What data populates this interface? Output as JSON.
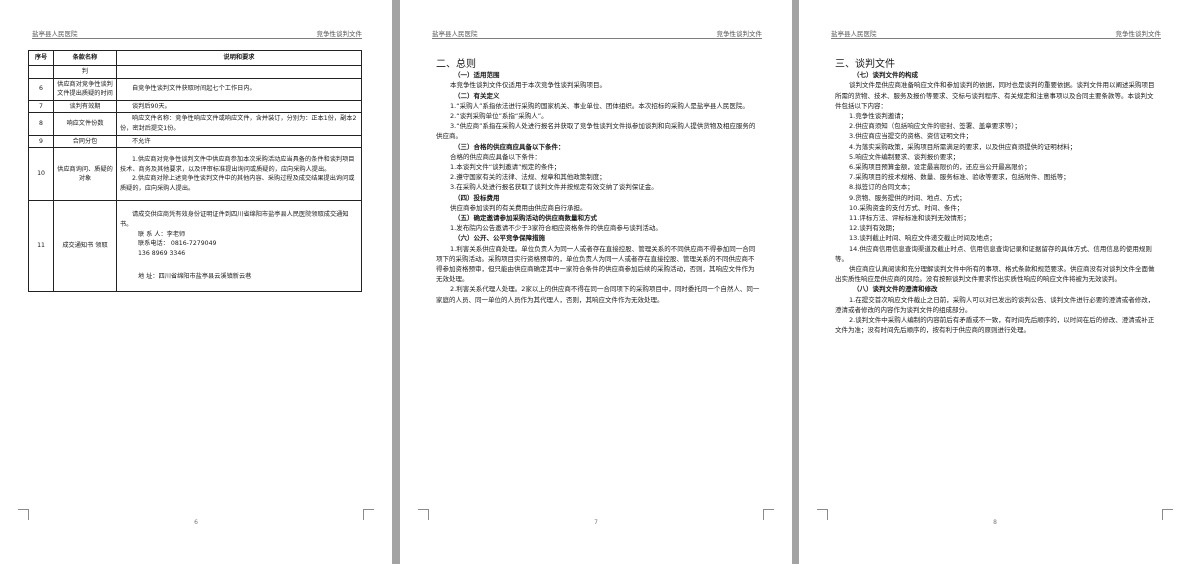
{
  "header": {
    "left": "盐亭县人民医院",
    "right": "竞争性谈判文件"
  },
  "page6": {
    "page_number": "6",
    "table_headers": [
      "序号",
      "条款名称",
      "说明和要求"
    ],
    "rows": [
      {
        "no": "",
        "name": "判",
        "desc": []
      },
      {
        "no": "6",
        "name": "供应商对竞争性谈判文件提出质疑的时间",
        "desc": [
          "自竞争性谈判文件获取时间起七个工作日内。"
        ]
      },
      {
        "no": "7",
        "name": "谈判有效期",
        "desc": [
          "谈判后90天。"
        ]
      },
      {
        "no": "8",
        "name": "响应文件份数",
        "desc": [
          "响应文件名称：竞争性响应文件或响应文件，含并装订，分别为：正本1份，副本2份，密封后提交1份。"
        ]
      },
      {
        "no": "9",
        "name": "合同分包",
        "desc": [
          "不允许"
        ]
      },
      {
        "no": "10",
        "name": "供应商询问、质疑的对象",
        "desc": [
          "1.供应商对竞争性谈判文件中供应商参加本次采购活动应当具备的条件和谈判项目技术、商务及其他要求，以及评审标准提出询问或质疑的，应向采购人提出。",
          "2.供应商对除上述竞争性谈判文件中的其他内容、采购过程及成交结果提出询问或质疑的，应向采购人提出。"
        ]
      },
      {
        "no": "11",
        "name": "成交通知书 领取",
        "desc": [
          "请成交供应商凭有效身份证明证件到四川省绵阳市盐亭县人民医院领取成交通知书。",
          "联 系 人：李老师",
          "联系电话： 0816-7279049",
          "136 8969 3346",
          "",
          "地    址：四川省绵阳市盐亭县云溪镇新云巷"
        ]
      }
    ]
  },
  "page7": {
    "page_number": "7",
    "section_title": "二、总则",
    "blocks": [
      {
        "type": "sub",
        "text": "（一）适用范围"
      },
      {
        "type": "p",
        "text": "本竞争性谈判文件仅适用于本次竞争性谈判采购项目。"
      },
      {
        "type": "sub",
        "text": "（二）有关定义"
      },
      {
        "type": "p",
        "text": "1.“采购人”系指依法进行采购的国家机关、事业单位、团体组织。本次招标的采购人是盐亭县人民医院。"
      },
      {
        "type": "p",
        "text": "2.“谈判采购单位”系指“采购人”。"
      },
      {
        "type": "p",
        "text": "3.“供应商”系指在采购人处进行报名并获取了竞争性谈判文件拟参加谈判和向采购人提供货物及相应服务的供应商。"
      },
      {
        "type": "sub",
        "text": "（三）合格的供应商应具备以下条件："
      },
      {
        "type": "p",
        "text": "合格的供应商应具备以下条件："
      },
      {
        "type": "p",
        "text": "1.本谈判文件“谈判邀请”规定的条件；"
      },
      {
        "type": "p",
        "text": "2.遵守国家有关的法律、法规、规章和其他政策制度；"
      },
      {
        "type": "p",
        "text": "3.在采购人处进行报名获取了谈判文件并按规定有效交纳了谈判保证金。"
      },
      {
        "type": "sub",
        "text": "（四）投标费用"
      },
      {
        "type": "p",
        "text": "供应商参加谈判的有关费用由供应商自行承担。"
      },
      {
        "type": "sub",
        "text": "（五）确定邀请参加采购活动的供应商数量和方式"
      },
      {
        "type": "p",
        "text": "1.发布院内公告邀请不少于3家符合相应资格条件的供应商参与谈判活动。"
      },
      {
        "type": "sub",
        "text": "（六）公开、公平竞争保障措施"
      },
      {
        "type": "p",
        "text": "1.利害关系供应商处理。单位负责人为同一人或者存在直接控股、管理关系的不同供应商不得参加同一合同项下的采购活动。采购项目实行资格预审的，单位负责人为同一人或者存在直接控股、管理关系的不同供应商不得参加资格预审，但只能由供应商确定其中一家符合条件的供应商参加后续的采购活动，否则，其响应文件作为无效处理。"
      },
      {
        "type": "p",
        "text": "2.利害关系代理人处理。2家以上的供应商不得在同一合同项下的采购项目中，同时委托同一个自然人、同一家庭的人员、同一单位的人员作为其代理人，否则，其响应文件作为无效处理。"
      }
    ]
  },
  "page8": {
    "page_number": "8",
    "section_title": "三、谈判文件",
    "blocks": [
      {
        "type": "sub",
        "text": "（七）谈判文件的构成"
      },
      {
        "type": "p",
        "text": "谈判文件是供应商准备响应文件和参加谈判的依据，同时也是谈判的重要依据。谈判文件用以阐述采购项目所需的货物、技术、服务及报价等要求、交标与谈判程序、有关规定和注意事项以及合同主要条款等。本谈判文件包括以下内容："
      },
      {
        "type": "p",
        "text": "1.竞争性谈判邀请；"
      },
      {
        "type": "p",
        "text": "2.供应商须知（包括响应文件的密封、签署、盖章要求等）；"
      },
      {
        "type": "p",
        "text": "3.供应商应当提交的资格、资信证明文件；"
      },
      {
        "type": "p",
        "text": "4.为落实采购政策，采购项目所需满足的要求，以及供应商须提供的证明材料；"
      },
      {
        "type": "p",
        "text": "5.响应文件编制要求、谈判报价要求；"
      },
      {
        "type": "p",
        "text": "6.采购项目预算金额，设定最高限价的，还应当公开最高限价；"
      },
      {
        "type": "p",
        "text": "7.采购项目的技术规格、数量、服务标准、验收等要求，包括附件、图纸等；"
      },
      {
        "type": "p",
        "text": "8.拟签订的合同文本；"
      },
      {
        "type": "p",
        "text": "9.货物、服务提供的时间、地点、方式；"
      },
      {
        "type": "p",
        "text": "10.采购资金的支付方式、时间、条件；"
      },
      {
        "type": "p",
        "text": "11.评标方法、评标标准和谈判无效情形；"
      },
      {
        "type": "p",
        "text": "12.谈判有效期；"
      },
      {
        "type": "p",
        "text": "13.谈判截止时间、响应文件递交截止时间及地点；"
      },
      {
        "type": "p",
        "text": "14.供应商信用信息查询渠道及截止时点、信用信息查询记录和证据留存的具体方式、信用信息的使用规则等。"
      },
      {
        "type": "p",
        "text": "供应商应认真阅读和充分理解谈判文件中所有的事项、格式条款和规范要求。供应商没有对谈判文件全面做出实质性响应是供应商的风险。没有按照谈判文件要求作出实质性响应的响应文件将被为无效谈判。"
      },
      {
        "type": "sub",
        "text": "（八）谈判文件的澄清和修改"
      },
      {
        "type": "p",
        "text": "1.在提交首次响应文件截止之日前，采购人可以对已发出的谈判公告、谈判文件进行必要的澄清或者修改，澄清或者修改的内容作为谈判文件的组成部分。"
      },
      {
        "type": "p",
        "text": "2.谈判文件中采购人编制的内容前后有矛盾或不一致，有时间先后顺序的，以时间在后的修改、澄清或补正文件为准；没有时间先后顺序的，按有利于供应商的原则进行处理。"
      }
    ]
  }
}
